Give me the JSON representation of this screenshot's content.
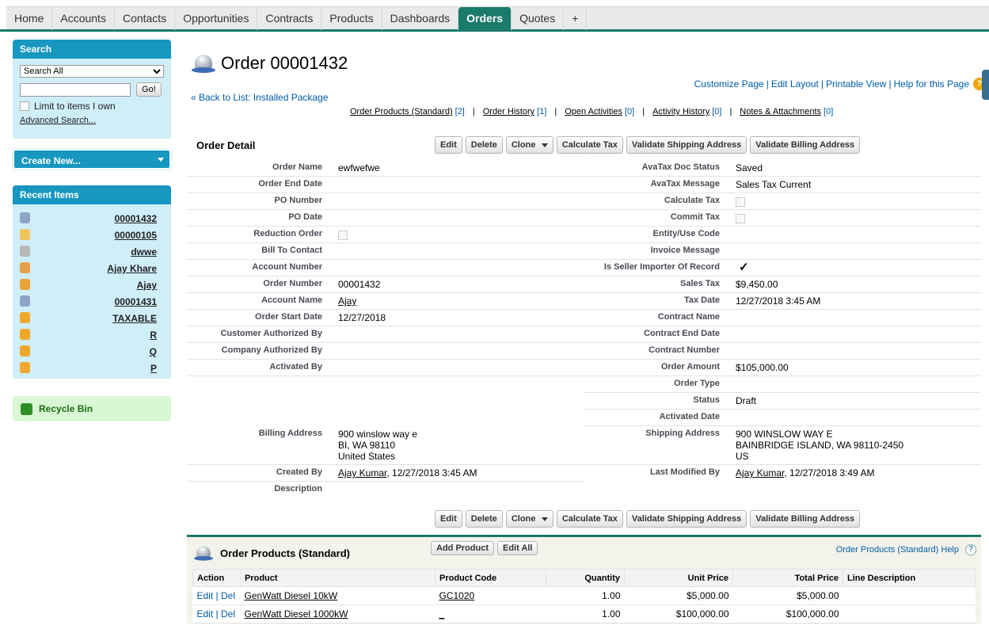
{
  "tabs": [
    {
      "label": "Home",
      "active": false
    },
    {
      "label": "Accounts",
      "active": false
    },
    {
      "label": "Contacts",
      "active": false
    },
    {
      "label": "Opportunities",
      "active": false
    },
    {
      "label": "Contracts",
      "active": false
    },
    {
      "label": "Products",
      "active": false
    },
    {
      "label": "Dashboards",
      "active": false
    },
    {
      "label": "Orders",
      "active": true
    },
    {
      "label": "Quotes",
      "active": false
    },
    {
      "label": "+",
      "active": false
    }
  ],
  "sidebar": {
    "search": {
      "title": "Search",
      "scope_selected": "Search All",
      "query_value": "",
      "go_label": "Go!",
      "limit_label": "Limit to items I own",
      "advanced_label": "Advanced Search..."
    },
    "create_new_label": "Create New...",
    "recent": {
      "title": "Recent Items",
      "items": [
        {
          "label": "00001432",
          "icon": "order-bell-icon"
        },
        {
          "label": "00000105",
          "icon": "contract-icon"
        },
        {
          "label": "dwwe",
          "icon": "generic-record-icon"
        },
        {
          "label": "Ajay Khare",
          "icon": "contact-icon"
        },
        {
          "label": "Ajay",
          "icon": "account-icon"
        },
        {
          "label": "00001431",
          "icon": "order-bell-icon"
        },
        {
          "label": "TAXABLE",
          "icon": "product-icon"
        },
        {
          "label": "R",
          "icon": "product-icon"
        },
        {
          "label": "Q",
          "icon": "product-icon"
        },
        {
          "label": "P",
          "icon": "product-icon"
        }
      ]
    },
    "recycle_bin_label": "Recycle Bin"
  },
  "header": {
    "title": "Order 00001432",
    "links": [
      "Customize Page",
      "Edit Layout",
      "Printable View",
      "Help for this Page"
    ],
    "back_link": "« Back to List: Installed Package",
    "related_links": [
      {
        "label": "Order Products (Standard)",
        "count": "[2]"
      },
      {
        "label": "Order History",
        "count": "[1]"
      },
      {
        "label": "Open Activities",
        "count": "[0]"
      },
      {
        "label": "Activity History",
        "count": "[0]"
      },
      {
        "label": "Notes & Attachments",
        "count": "[0]"
      }
    ]
  },
  "detail": {
    "title": "Order Detail",
    "buttons": [
      "Edit",
      "Delete",
      "Clone",
      "Calculate Tax",
      "Validate Shipping Address",
      "Validate Billing Address"
    ],
    "rows": [
      {
        "l": "Order Name",
        "v": "ewfwefwe",
        "rl": "AvaTax Doc Status",
        "rv": "Saved"
      },
      {
        "l": "Order End Date",
        "v": "",
        "rl": "AvaTax Message",
        "rv": "Sales Tax Current"
      },
      {
        "l": "PO Number",
        "v": "",
        "rl": "Calculate Tax",
        "rv": "",
        "rchk": "unchecked"
      },
      {
        "l": "PO Date",
        "v": "",
        "rl": "Commit Tax",
        "rv": "",
        "rchk": "unchecked"
      },
      {
        "l": "Reduction Order",
        "v": "",
        "chk": "unchecked",
        "rl": "Entity/Use Code",
        "rv": ""
      },
      {
        "l": "Bill To Contact",
        "v": "",
        "rl": "Invoice Message",
        "rv": ""
      },
      {
        "l": "Account Number",
        "v": "",
        "rl": "Is Seller Importer Of Record",
        "rv": "",
        "rchk": "checked"
      },
      {
        "l": "Order Number",
        "v": "00001432",
        "rl": "Sales Tax",
        "rv": "$9,450.00"
      },
      {
        "l": "Account Name",
        "v": "Ajay",
        "vlink": true,
        "rl": "Tax Date",
        "rv": "12/27/2018 3:45 AM"
      },
      {
        "l": "Order Start Date",
        "v": "12/27/2018",
        "rl": "Contract Name",
        "rv": ""
      },
      {
        "l": "Customer Authorized By",
        "v": "",
        "rl": "Contract End Date",
        "rv": ""
      },
      {
        "l": "Company Authorized By",
        "v": "",
        "rl": "Contract Number",
        "rv": ""
      },
      {
        "l": "Activated By",
        "v": "",
        "rl": "Order Amount",
        "rv": "$105,000.00"
      },
      {
        "l": "",
        "v": "",
        "rl": "Order Type",
        "rv": ""
      },
      {
        "l": "",
        "v": "",
        "rl": "Status",
        "rv": "Draft"
      },
      {
        "l": "",
        "v": "",
        "rl": "Activated Date",
        "rv": ""
      }
    ],
    "billing_label": "Billing Address",
    "billing_lines": [
      "900 winslow way e",
      "BI, WA 98110",
      "United States"
    ],
    "shipping_label": "Shipping Address",
    "shipping_lines": [
      "900 WINSLOW WAY E",
      "BAINBRIDGE ISLAND, WA 98110-2450",
      "US"
    ],
    "created_label": "Created By",
    "created_user": "Ajay Kumar",
    "created_date": ", 12/27/2018 3:45 AM",
    "modified_label": "Last Modified By",
    "modified_user": "Ajay Kumar",
    "modified_date": ", 12/27/2018 3:49 AM",
    "description_label": "Description",
    "description_value": ""
  },
  "order_products": {
    "title": "Order Products (Standard)",
    "buttons": [
      "Add Product",
      "Edit All"
    ],
    "help_label": "Order Products (Standard) Help",
    "columns": [
      "Action",
      "Product",
      "Product Code",
      "Quantity",
      "Unit Price",
      "Total Price",
      "Line Description"
    ],
    "rows": [
      {
        "product": "GenWatt Diesel 10kW",
        "code": "GC1020",
        "qty": "1.00",
        "unit": "$5,000.00",
        "total": "$5,000.00",
        "desc": ""
      },
      {
        "product": "GenWatt Diesel 1000kW",
        "code": "_",
        "qty": "1.00",
        "unit": "$100,000.00",
        "total": "$100,000.00",
        "desc": ""
      }
    ],
    "edit_label": "Edit",
    "del_label": "Del"
  }
}
